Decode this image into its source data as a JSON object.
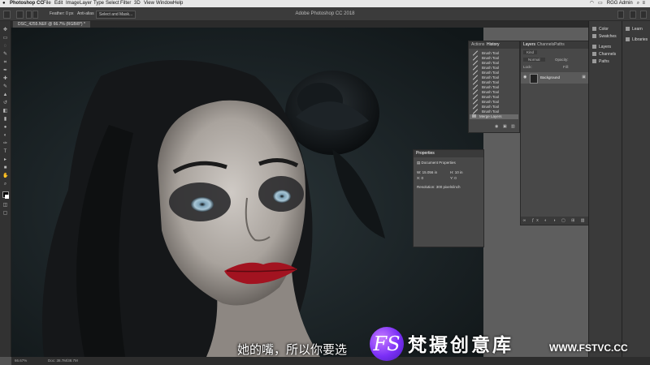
{
  "menubar": {
    "items": [
      "Photoshop CC",
      "File",
      "Edit",
      "Image",
      "Layer",
      "Type",
      "Select",
      "Filter",
      "3D",
      "View",
      "Window",
      "Help"
    ],
    "user": "RGG Admin"
  },
  "optionsbar": {
    "feather": "Feather: 0 px",
    "anti_alias": "Anti-alias",
    "select_mask": "Select and Mask...",
    "app_title": "Adobe Photoshop CC 2018"
  },
  "document": {
    "tab": "DSC_4255.NEF @ 66.7% (RGB/8*) *"
  },
  "history_panel": {
    "tabs": [
      "Actions",
      "History"
    ],
    "items": [
      "Brush Tool",
      "Brush Tool",
      "Brush Tool",
      "Brush Tool",
      "Brush Tool",
      "Brush Tool",
      "Brush Tool",
      "Brush Tool",
      "Brush Tool",
      "Brush Tool",
      "Brush Tool",
      "Brush Tool",
      "Brush Tool",
      "Merge Layers"
    ]
  },
  "layers_panel": {
    "tabs": [
      "Layers",
      "Channels",
      "Paths"
    ],
    "filter": "Kind",
    "blend": "Normal",
    "opacity": "Opacity:",
    "lock": "Lock:",
    "fill": "Fill:",
    "layer_name": "Background"
  },
  "properties_panel": {
    "title": "Properties",
    "subtitle": "Document Properties",
    "w": "W: 15.056 in",
    "h": "H: 10 in",
    "x": "X: 0",
    "y": "Y: 0",
    "resolution": "Resolution: 300 pixels/inch"
  },
  "dock": {
    "col1": [
      "Color",
      "Swatches",
      "Layers",
      "Channels",
      "Paths"
    ],
    "col2": [
      "Learn",
      "Libraries"
    ]
  },
  "statusbar": {
    "zoom": "66.67%",
    "doc": "Doc: 38.7M/38.7M"
  },
  "subtitle": "她的嘴，所以你要选",
  "watermark": {
    "logo": "FS",
    "name": "梵摄创意库",
    "url": "WWW.FSTVC.CC"
  }
}
